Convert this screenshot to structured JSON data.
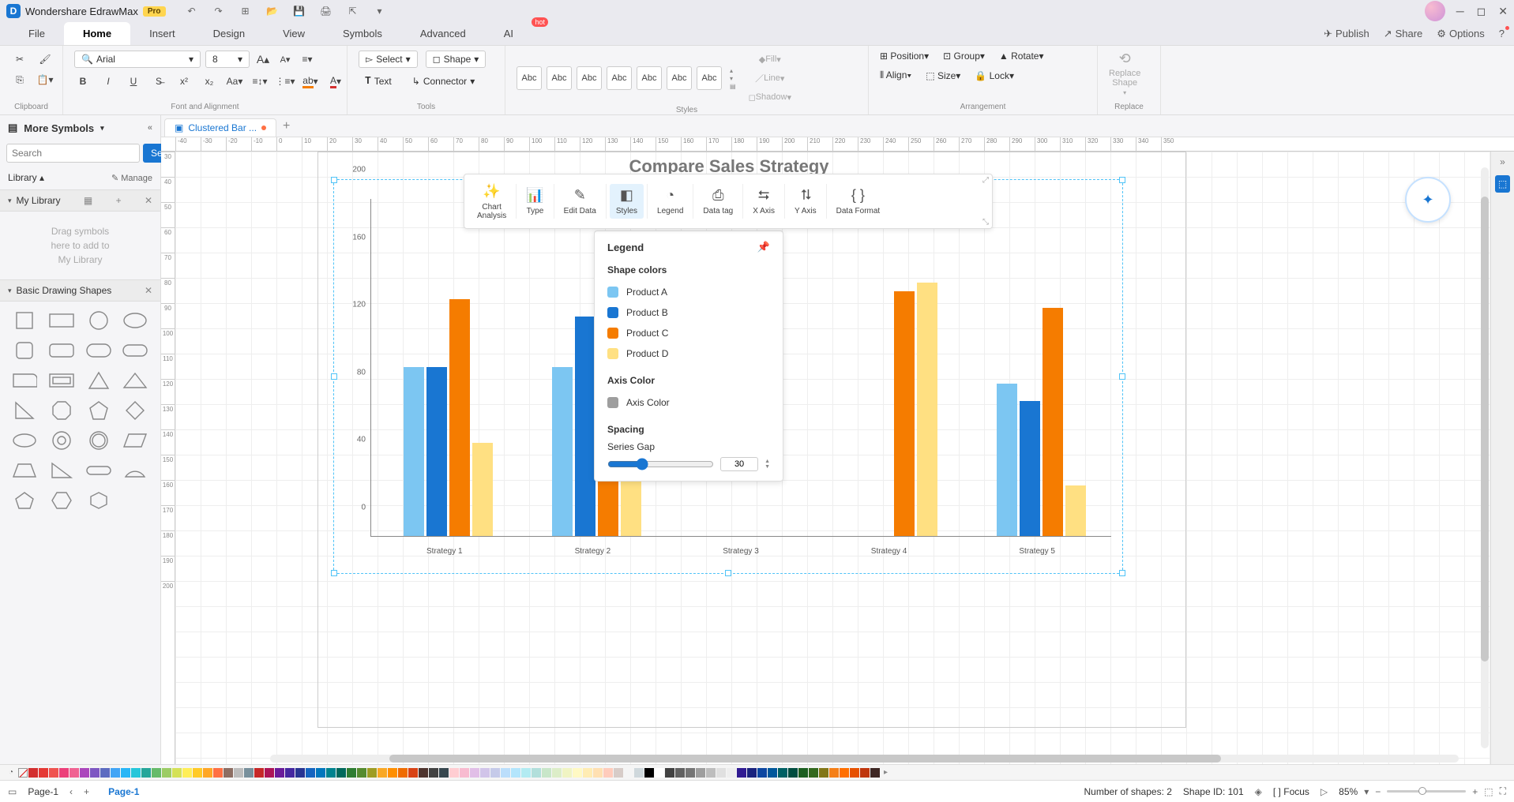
{
  "app": {
    "title": "Wondershare EdrawMax",
    "pro": "Pro"
  },
  "menu": {
    "tabs": [
      "File",
      "Home",
      "Insert",
      "Design",
      "View",
      "Symbols",
      "Advanced",
      "AI"
    ],
    "active": "Home",
    "hot": "hot",
    "right": {
      "publish": "Publish",
      "share": "Share",
      "options": "Options"
    }
  },
  "ribbon": {
    "clipboard": {
      "label": "Clipboard"
    },
    "font": {
      "label": "Font and Alignment",
      "font_name": "Arial",
      "font_size": "8"
    },
    "tools": {
      "label": "Tools",
      "select": "Select",
      "text": "Text",
      "shape": "Shape",
      "connector": "Connector"
    },
    "styles": {
      "label": "Styles",
      "swatch": "Abc",
      "fill": "Fill",
      "line": "Line",
      "shadow": "Shadow"
    },
    "arrangement": {
      "label": "Arrangement",
      "position": "Position",
      "align": "Align",
      "group": "Group",
      "size": "Size",
      "rotate": "Rotate",
      "lock": "Lock"
    },
    "replace": {
      "label": "Replace",
      "replace_shape": "Replace\nShape"
    }
  },
  "leftpanel": {
    "more_symbols": "More Symbols",
    "search_btn": "Search",
    "search_ph": "Search",
    "library": "Library",
    "manage": "Manage",
    "my_library": "My Library",
    "drop_hint": "Drag symbols\nhere to add to\nMy Library",
    "basic_shapes": "Basic Drawing Shapes"
  },
  "doc": {
    "tab_name": "Clustered Bar ..."
  },
  "ruler_h": [
    -40,
    -30,
    -20,
    -10,
    0,
    10,
    20,
    30,
    40,
    50,
    60,
    70,
    80,
    90,
    100,
    110,
    120,
    130,
    140,
    150,
    160,
    170,
    180,
    190,
    200,
    210,
    220,
    230,
    240,
    250,
    260,
    270,
    280,
    290,
    300,
    310,
    320,
    330,
    340,
    350
  ],
  "ruler_v": [
    30,
    40,
    50,
    60,
    70,
    80,
    90,
    100,
    110,
    120,
    130,
    140,
    150,
    160,
    170,
    180,
    190,
    200
  ],
  "chart_toolbar": {
    "items": [
      {
        "id": "chart-analysis",
        "label": "Chart\nAnalysis"
      },
      {
        "id": "type",
        "label": "Type"
      },
      {
        "id": "edit-data",
        "label": "Edit Data"
      },
      {
        "id": "styles",
        "label": "Styles"
      },
      {
        "id": "legend",
        "label": "Legend"
      },
      {
        "id": "data-tag",
        "label": "Data tag"
      },
      {
        "id": "x-axis",
        "label": "X Axis"
      },
      {
        "id": "y-axis",
        "label": "Y Axis"
      },
      {
        "id": "data-format",
        "label": "Data Format"
      }
    ],
    "active": "styles"
  },
  "legend_popup": {
    "title": "Legend",
    "shape_colors": "Shape colors",
    "items": [
      {
        "name": "Product A",
        "color": "#7cc6f2"
      },
      {
        "name": "Product B",
        "color": "#1976d2"
      },
      {
        "name": "Product C",
        "color": "#f57c00"
      },
      {
        "name": "Product D",
        "color": "#ffe082"
      }
    ],
    "axis_color_label": "Axis Color",
    "axis_color_item": "Axis Color",
    "axis_color_sw": "#9e9e9e",
    "spacing": "Spacing",
    "series_gap": "Series Gap",
    "series_gap_value": "30"
  },
  "chart_data": {
    "type": "bar",
    "title": "Compare Sales Strategy",
    "xlabel": "",
    "ylabel": "",
    "ylim": [
      0,
      200
    ],
    "yticks": [
      0,
      40,
      80,
      120,
      160,
      200
    ],
    "categories": [
      "Strategy 1",
      "Strategy 2",
      "Strategy 3",
      "Strategy 4",
      "Strategy 5"
    ],
    "series": [
      {
        "name": "Product A",
        "color": "#7cc6f2",
        "values": [
          100,
          100,
          null,
          null,
          90
        ]
      },
      {
        "name": "Product B",
        "color": "#1976d2",
        "values": [
          100,
          130,
          null,
          null,
          80
        ]
      },
      {
        "name": "Product C",
        "color": "#f57c00",
        "values": [
          140,
          140,
          null,
          145,
          135
        ]
      },
      {
        "name": "Product D",
        "color": "#ffe082",
        "values": [
          55,
          150,
          null,
          150,
          30
        ]
      }
    ]
  },
  "color_palette": [
    "#d32f2f",
    "#e53935",
    "#ef5350",
    "#ec407a",
    "#f06292",
    "#ab47bc",
    "#7e57c2",
    "#5c6bc0",
    "#42a5f5",
    "#29b6f6",
    "#26c6da",
    "#26a69a",
    "#66bb6a",
    "#9ccc65",
    "#d4e157",
    "#ffee58",
    "#ffca28",
    "#ffa726",
    "#ff7043",
    "#8d6e63",
    "#bdbdbd",
    "#78909c",
    "#c62828",
    "#ad1457",
    "#6a1b9a",
    "#4527a0",
    "#283593",
    "#1565c0",
    "#0277bd",
    "#00838f",
    "#00695c",
    "#2e7d32",
    "#558b2f",
    "#9e9d24",
    "#f9a825",
    "#ff8f00",
    "#ef6c00",
    "#d84315",
    "#4e342e",
    "#424242",
    "#37474f",
    "#ffcdd2",
    "#f8bbd0",
    "#e1bee7",
    "#d1c4e9",
    "#c5cae9",
    "#bbdefb",
    "#b3e5fc",
    "#b2ebf2",
    "#b2dfdb",
    "#c8e6c9",
    "#dcedc8",
    "#f0f4c3",
    "#fff9c4",
    "#ffecb3",
    "#ffe0b2",
    "#ffccbc",
    "#d7ccc8",
    "#f5f5f5",
    "#cfd8dc",
    "#000000",
    "#ffffff",
    "#424242",
    "#616161",
    "#757575",
    "#9e9e9e",
    "#bdbdbd",
    "#e0e0e0",
    "#eeeeee",
    "#311b92",
    "#1a237e",
    "#0d47a1",
    "#01579b",
    "#006064",
    "#004d40",
    "#1b5e20",
    "#33691e",
    "#827717",
    "#f57f17",
    "#ff6f00",
    "#e65100",
    "#bf360c",
    "#3e2723"
  ],
  "statusbar": {
    "page_tab": "Page-1",
    "page_name": "Page-1",
    "shapes": "Number of shapes: 2",
    "shape_id": "Shape ID: 101",
    "focus": "Focus",
    "zoom": "85%"
  }
}
